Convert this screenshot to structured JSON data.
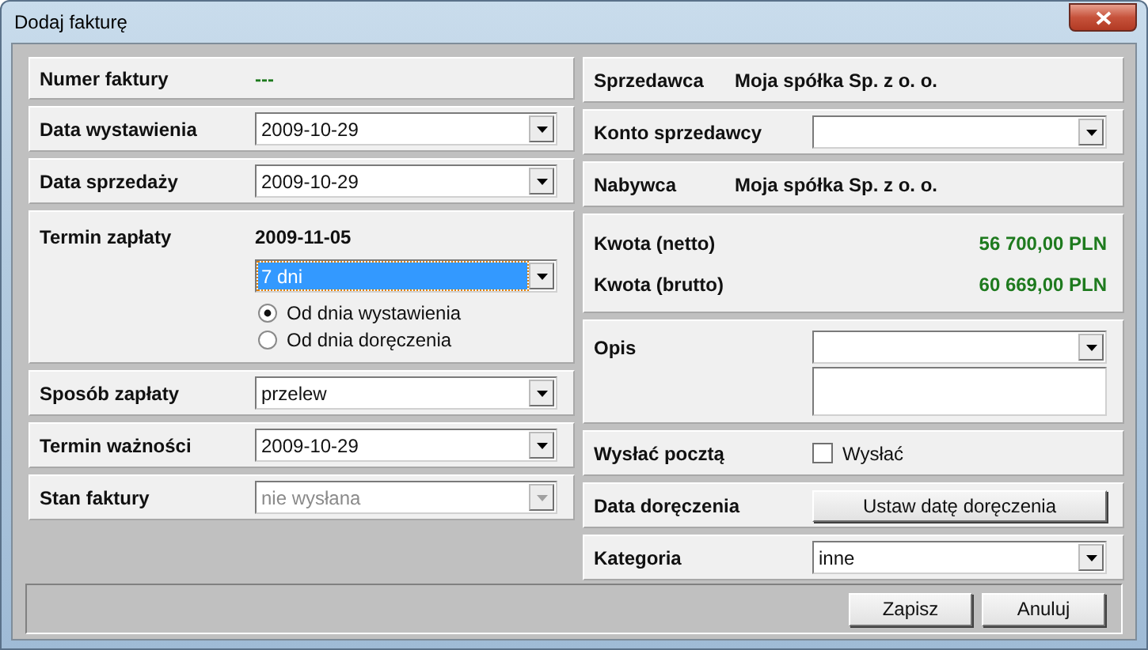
{
  "window": {
    "title": "Dodaj fakturę"
  },
  "left": [
    {
      "kind": "text",
      "label": "Numer faktury",
      "value": "---",
      "color": "#1e7a1e"
    },
    {
      "kind": "select",
      "label": "Data wystawienia",
      "value": "2009-10-29",
      "disabled": false
    },
    {
      "kind": "select",
      "label": "Data sprzedaży",
      "value": "2009-10-29",
      "disabled": false
    },
    {
      "kind": "payment_term",
      "label": "Termin zapłaty",
      "date": "2009-11-05",
      "select": {
        "value": "7 dni",
        "highlighted": true
      },
      "options": [
        {
          "label": "Od dnia wystawienia",
          "selected": true
        },
        {
          "label": "Od dnia doręczenia",
          "selected": false
        }
      ]
    },
    {
      "kind": "select",
      "label": "Sposób zapłaty",
      "value": "przelew",
      "disabled": false
    },
    {
      "kind": "select",
      "label": "Termin ważności",
      "value": "2009-10-29",
      "disabled": false
    },
    {
      "kind": "select",
      "label": "Stan faktury",
      "value": "nie wysłana",
      "disabled": true
    }
  ],
  "right": [
    {
      "kind": "text",
      "label": "Sprzedawca",
      "value": "Moja spółka Sp. z o. o.",
      "color": "#111111"
    },
    {
      "kind": "select",
      "label": "Konto sprzedawcy",
      "disabled": false
    },
    {
      "kind": "text",
      "label": "Nabywca",
      "value": "Moja spółka Sp. z o. o.",
      "color": "#111111"
    },
    {
      "kind": "amounts",
      "items": [
        {
          "label": "Kwota (netto)",
          "value": "56 700,00 PLN"
        },
        {
          "label": "Kwota (brutto)",
          "value": "60 669,00 PLN"
        }
      ]
    },
    {
      "kind": "description",
      "label": "Opis"
    },
    {
      "kind": "checkbox",
      "label": "Wysłać pocztą",
      "checkbox_label": "Wysłać",
      "checked": false
    },
    {
      "kind": "button",
      "label": "Data doręczenia",
      "button": "Ustaw datę doręczenia"
    },
    {
      "kind": "select",
      "label": "Kategoria",
      "value": "inne",
      "disabled": false
    }
  ],
  "buttons": [
    "Zapisz",
    "Anuluj"
  ]
}
